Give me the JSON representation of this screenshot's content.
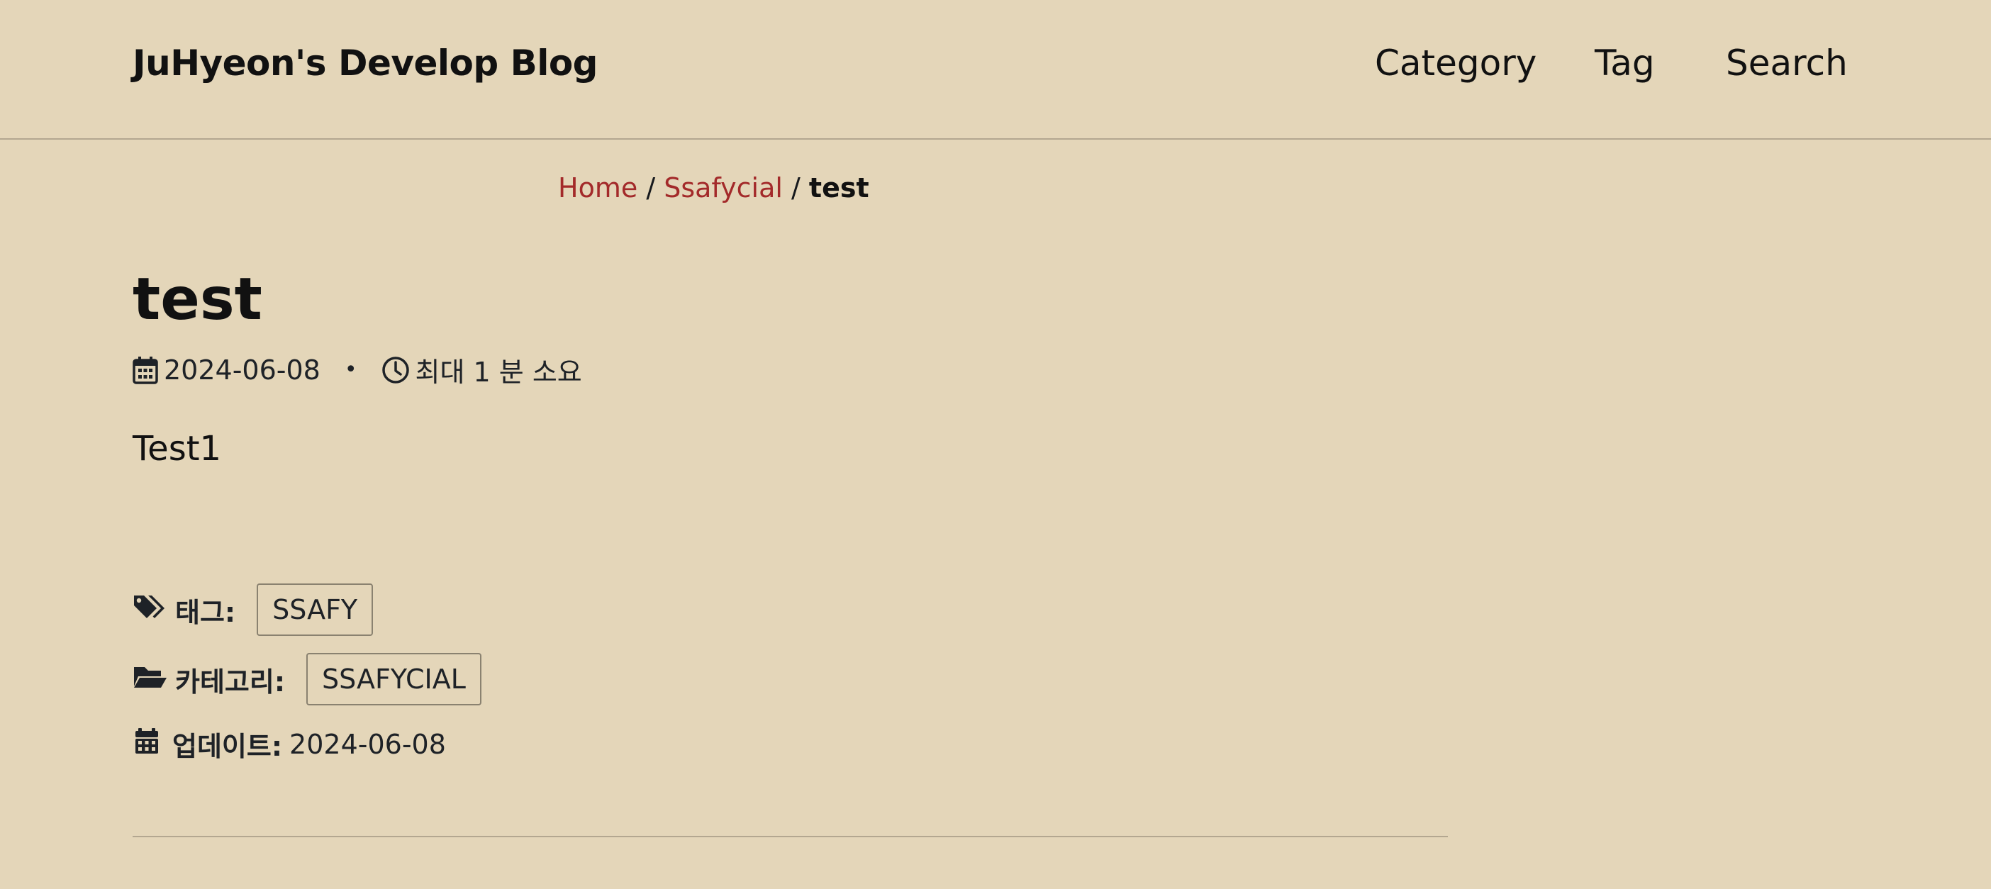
{
  "header": {
    "site_title": "JuHyeon's Develop Blog",
    "nav": {
      "category": "Category",
      "tag": "Tag",
      "search": "Search"
    }
  },
  "breadcrumb": {
    "home": "Home",
    "separator": "/",
    "section": "Ssafycial",
    "current": "test"
  },
  "post": {
    "title": "test",
    "date": "2024-06-08",
    "meta_separator": "•",
    "read_time": "최대 1 분 소요",
    "content": "Test1",
    "tags_label": "태그:",
    "tags": [
      "SSAFY"
    ],
    "categories_label": "카테고리:",
    "categories": [
      "SSAFYCIAL"
    ],
    "updated_label": "업데이트:",
    "updated_date": "2024-06-08"
  },
  "icons": {
    "meta_date": "calendar-icon",
    "meta_read_time": "clock-icon",
    "tags": "tags-icon",
    "categories": "folder-open-icon",
    "updated": "calendar-icon"
  },
  "colors": {
    "background": "#e4d6b9",
    "link": "#a32a2a",
    "text": "#16191d",
    "divider": "#b3a790"
  }
}
